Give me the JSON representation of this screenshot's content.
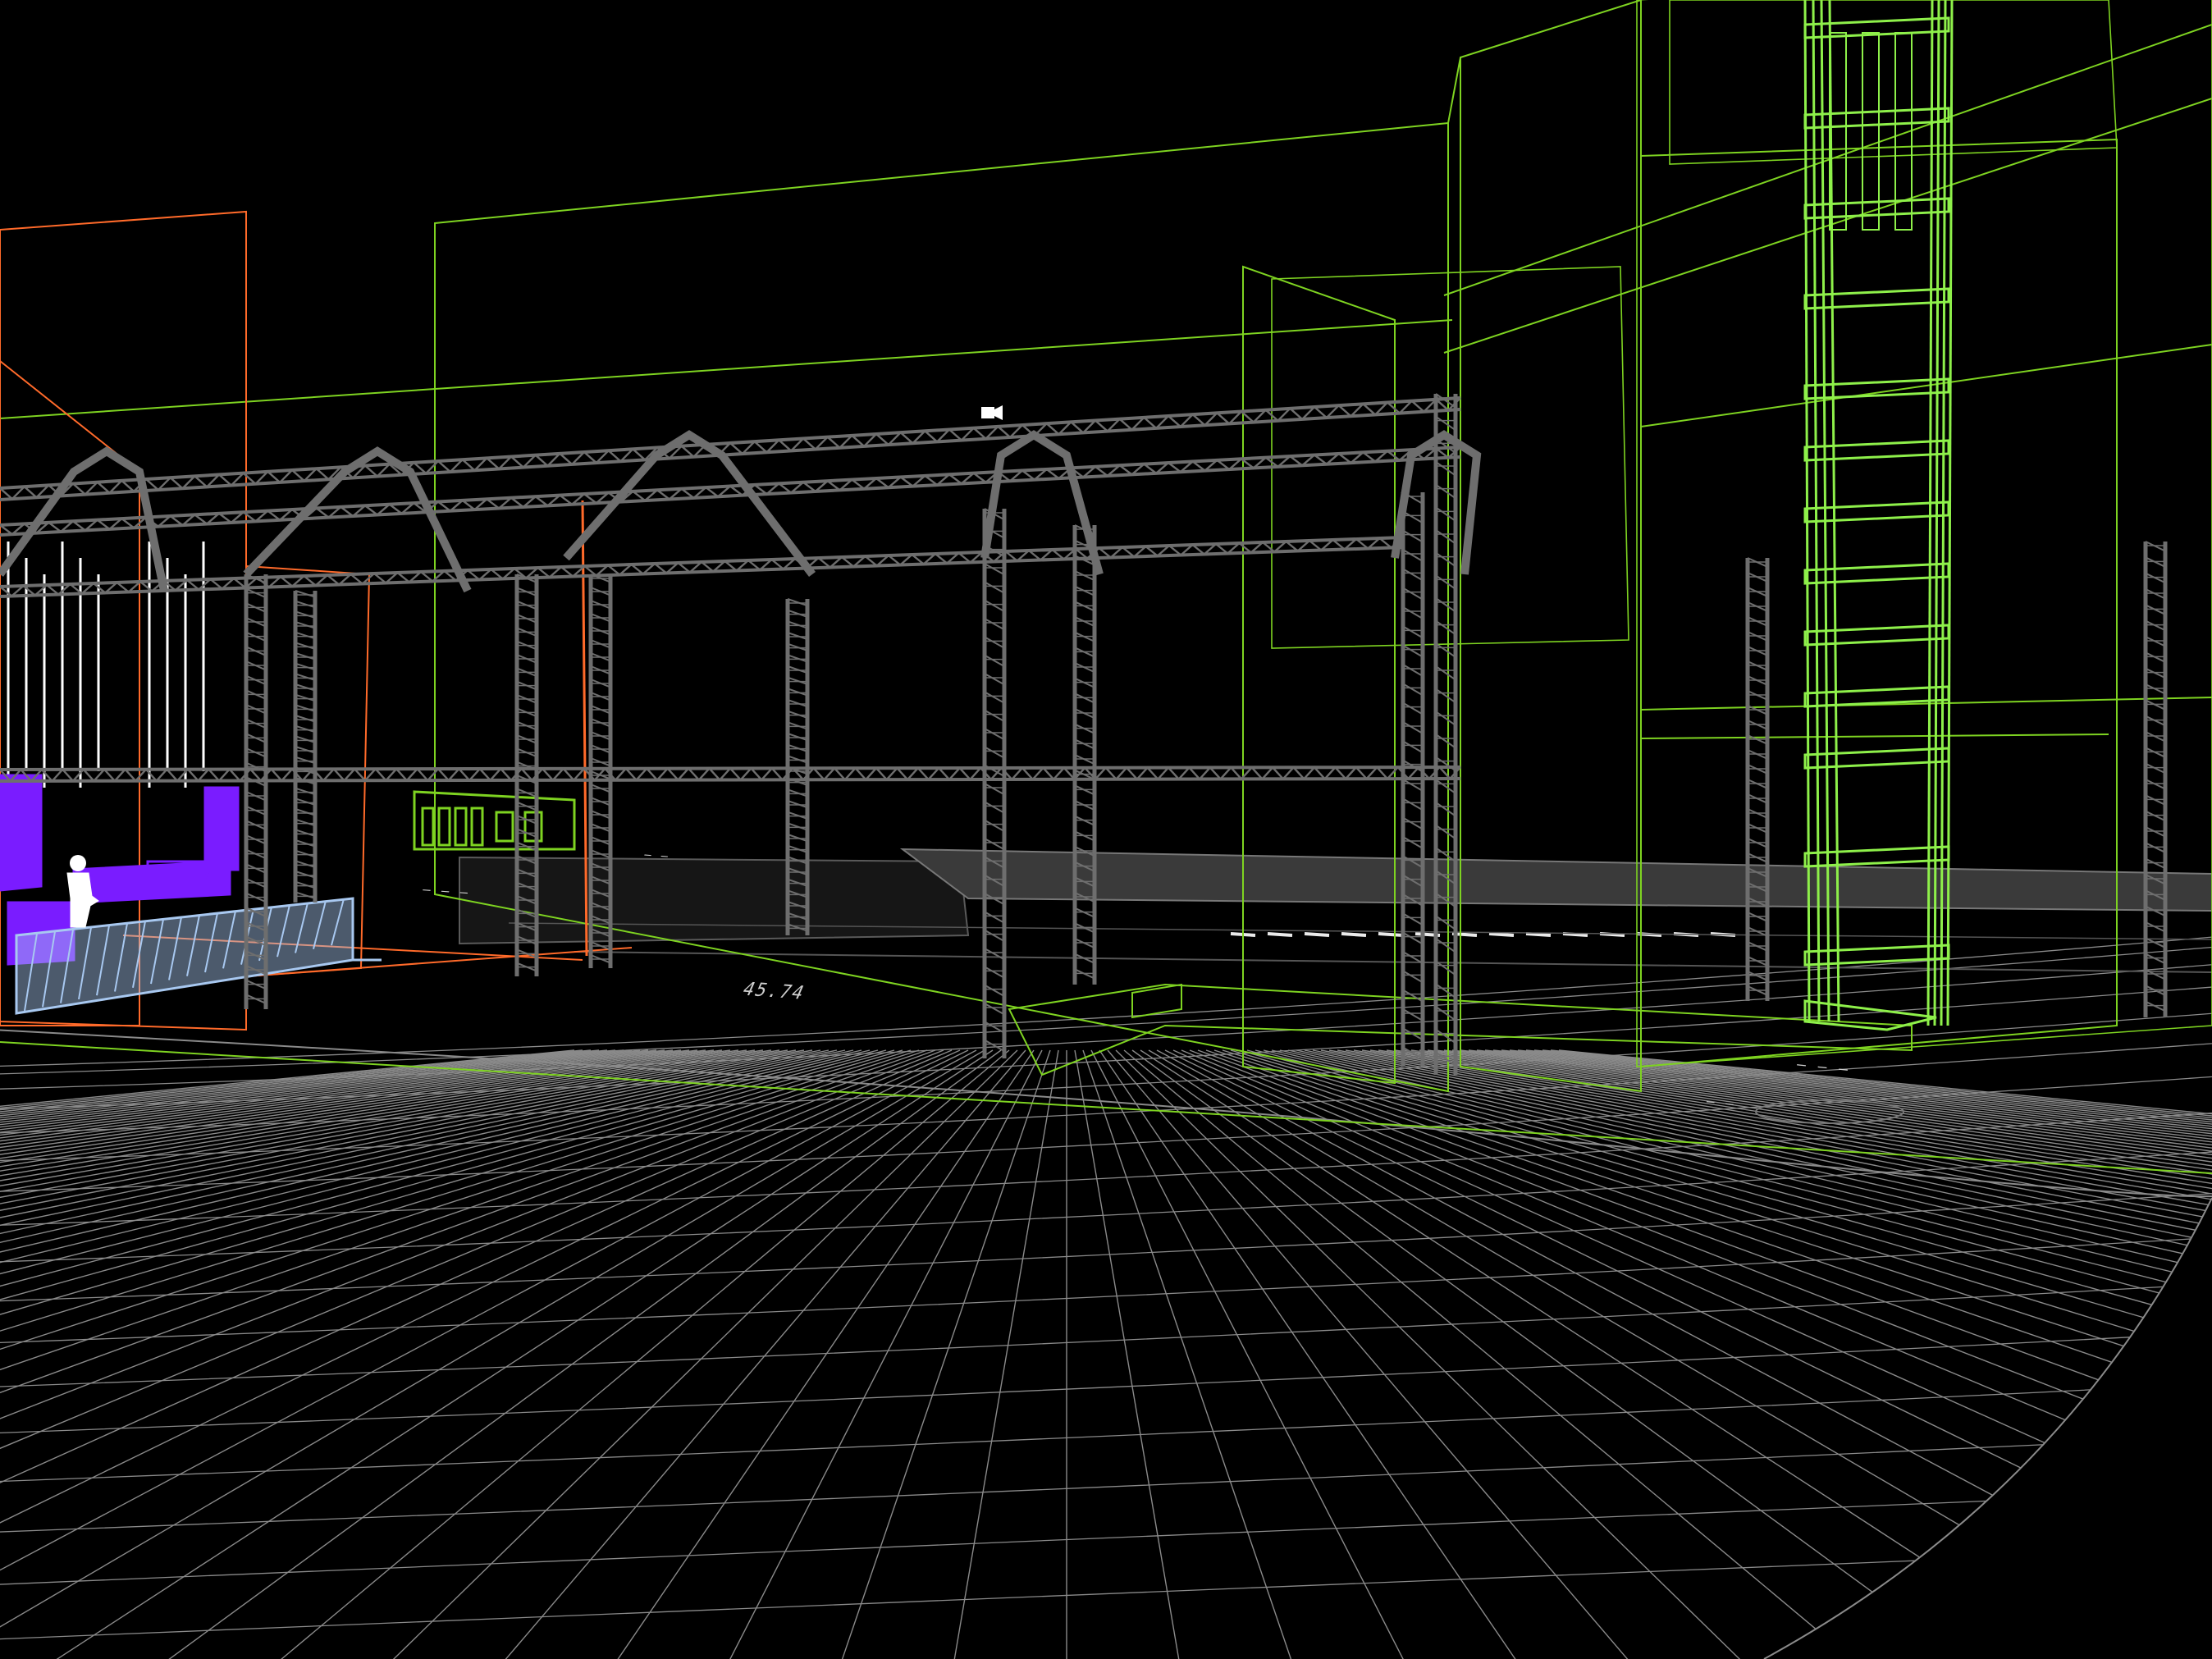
{
  "app": {
    "kind": "3D wireframe CAD viewport",
    "view_mode": "wireframe"
  },
  "colors": {
    "background": "#000000",
    "floor_grid": "#8a8a8a",
    "truss": "#6e6e6e",
    "building_outline": "#7ed321",
    "stage_outline": "#ff6a2a",
    "stage_furniture": "#7a1cff",
    "barrier": "#a8c8f0",
    "lights": "#ffffff",
    "figure": "#ffffff",
    "floor_text": "#d0d0d0"
  },
  "icons": {
    "camera": "camera-icon",
    "figure": "person-icon"
  },
  "floor_labels": {
    "a": "45.74",
    "b": "— — —",
    "c": "— —",
    "d": "— — —",
    "e": "— —"
  }
}
